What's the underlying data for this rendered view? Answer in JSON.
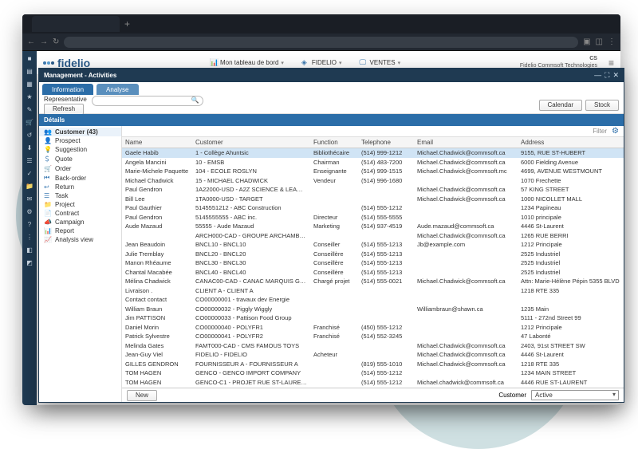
{
  "brand": "fidelio",
  "header": {
    "links": [
      {
        "icon": "📊",
        "label": "Mon tableau de bord"
      },
      {
        "icon": "◈",
        "label": "FIDELIO"
      },
      {
        "icon": "🖵",
        "label": "VENTES"
      }
    ],
    "user_code": "CS",
    "user_org": "Fidelio Commsoft Technologies",
    "menu": "≡"
  },
  "rail_icons": [
    "■",
    "▤",
    "▦",
    "★",
    "✎",
    "🛒",
    "↺",
    "⬇",
    "☰",
    "✓",
    "📁",
    "✉",
    "⚙",
    "?",
    "⋮",
    "◧",
    "◩"
  ],
  "modal": {
    "title": "Management - Activities",
    "tabs": {
      "active": "Information",
      "other": "Analyse"
    },
    "representative_label": "Representative",
    "refresh": "Refresh",
    "calendar": "Calendar",
    "stock": "Stock",
    "details_panel": "Détails",
    "filter": "Filter",
    "new": "New",
    "footer_customer": "Customer",
    "footer_active": "Active"
  },
  "sidebar": {
    "items": [
      {
        "icon": "👥",
        "label": "Customer (43)"
      },
      {
        "icon": "👤",
        "label": "Prospect"
      },
      {
        "icon": "💡",
        "label": "Suggestion"
      },
      {
        "icon": "＄",
        "label": "Quote"
      },
      {
        "icon": "🛒",
        "label": "Order"
      },
      {
        "icon": "⏮",
        "label": "Back-order"
      },
      {
        "icon": "↩",
        "label": "Return"
      },
      {
        "icon": "☰",
        "label": "Task"
      },
      {
        "icon": "📁",
        "label": "Project"
      },
      {
        "icon": "📄",
        "label": "Contract"
      },
      {
        "icon": "📣",
        "label": "Campaign"
      },
      {
        "icon": "📊",
        "label": "Report"
      },
      {
        "icon": "📈",
        "label": "Analysis view"
      }
    ]
  },
  "grid": {
    "columns": [
      "Name",
      "Customer",
      "Function",
      "Telephone",
      "Email",
      "Address"
    ],
    "rows": [
      {
        "name": "Gaele Habib",
        "customer": "1 - Collège Ahuntsic",
        "func": "Bibliothécaire",
        "tel": "(514) 999-1212",
        "email": "Michael.Chadwick@commsoft.ca",
        "addr": "9155, RUE ST-HUBERT"
      },
      {
        "name": "Angela Mancini",
        "customer": "10 - EMSB",
        "func": "Chairman",
        "tel": "(514) 483-7200",
        "email": "Michael.Chadwick@commsoft.ca",
        "addr": "6000 Fielding Avenue"
      },
      {
        "name": "Marie-Michele Paquette",
        "customer": "104 - ECOLE ROSLYN",
        "func": "Enseignante",
        "tel": "(514) 999-1515",
        "email": "Michael.Chadwick@commsoft.mc",
        "addr": "4699, AVENUE WESTMOUNT"
      },
      {
        "name": "Michael Chadwick",
        "customer": "15 - MICHAEL CHADWICK",
        "func": "Vendeur",
        "tel": "(514) 996-1680",
        "email": "",
        "addr": "1070 Frechette"
      },
      {
        "name": "Paul Gendron",
        "customer": "1A22000-USD - A2Z SCIENCE & LEARNING…",
        "func": "",
        "tel": "",
        "email": "Michael.Chadwick@commsoft.ca",
        "addr": "57 KING STREET"
      },
      {
        "name": "Bill Lee",
        "customer": "1TA0000-USD - TARGET",
        "func": "",
        "tel": "",
        "email": "Michael.Chadwick@commsoft.ca",
        "addr": "1000 NICOLLET MALL"
      },
      {
        "name": "Paul Gauthier",
        "customer": "5145551212 - ABC Construction",
        "func": "",
        "tel": "(514) 555-1212",
        "email": "",
        "addr": "1234 Papineau"
      },
      {
        "name": "Paul Gendron",
        "customer": "5145555555 - ABC inc.",
        "func": "Directeur",
        "tel": "(514) 555-5555",
        "email": "",
        "addr": "1010 principale"
      },
      {
        "name": "Aude Mazaud",
        "customer": "55555 - Aude Mazaud",
        "func": "Marketing",
        "tel": "(514) 937-4519",
        "email": "Aude.mazaud@commsoft.ca",
        "addr": "4446 St-Laurent"
      },
      {
        "name": "",
        "customer": "ARCH000-CAD - GROUPE ARCHAMBAULT",
        "func": "",
        "tel": "",
        "email": "Michael.Chadwick@commsoft.ca",
        "addr": "1265 RUE BERRI"
      },
      {
        "name": "Jean Beaudoin",
        "customer": "BNCL10 - BNCL10",
        "func": "Conseiller",
        "tel": "(514) 555-1213",
        "email": "Jb@example.com",
        "addr": "1212 Principale"
      },
      {
        "name": "Julie Tremblay",
        "customer": "BNCL20 - BNCL20",
        "func": "Conseillère",
        "tel": "(514) 555-1213",
        "email": "",
        "addr": "2525 Industriel"
      },
      {
        "name": "Manon Rhéaume",
        "customer": "BNCL30 - BNCL30",
        "func": "Conseillère",
        "tel": "(514) 555-1213",
        "email": "",
        "addr": "2525 Industriel"
      },
      {
        "name": "Chantal Macabée",
        "customer": "BNCL40 - BNCL40",
        "func": "Conseillère",
        "tel": "(514) 555-1213",
        "email": "",
        "addr": "2525 Industriel"
      },
      {
        "name": "Mélina Chadwick",
        "customer": "CANAC00-CAD - CANAC MARQUIS GRENI…",
        "func": "Chargé projet",
        "tel": "(514) 555-0021",
        "email": "Michael.Chadwick@commsoft.ca",
        "addr": "Attn: Marie-Hélène Pépin 5355 BLVD"
      },
      {
        "name": "Livraison .",
        "customer": "CLIENT A - CLIENT A",
        "func": "",
        "tel": "",
        "email": "",
        "addr": "1218 RTE 335"
      },
      {
        "name": "Contact contact",
        "customer": "CO00000001 - travaux dev Energie",
        "func": "",
        "tel": "",
        "email": "",
        "addr": ""
      },
      {
        "name": "William Braun",
        "customer": "CO00000032 - Piggly Wiggly",
        "func": "",
        "tel": "",
        "email": "Williambraun@shawn.ca",
        "addr": "1235 Main"
      },
      {
        "name": "Jim PATTISON",
        "customer": "CO00000033 - Pattison Food Group",
        "func": "",
        "tel": "",
        "email": "",
        "addr": "5111 - 272nd Street 99"
      },
      {
        "name": "Daniel Morin",
        "customer": "CO00000040 - POLYFR1",
        "func": "Franchisé",
        "tel": "(450) 555-1212",
        "email": "",
        "addr": "1212 Principale"
      },
      {
        "name": "Patrick Sylvestre",
        "customer": "CO00000041 - POLYFR2",
        "func": "Franchisé",
        "tel": "(514) 552-3245",
        "email": "",
        "addr": "47 Labonté"
      },
      {
        "name": "Melinda Gates",
        "customer": "FAMT000-CAD - CMS FAMOUS TOYS",
        "func": "",
        "tel": "",
        "email": "Michael.Chadwick@commsoft.ca",
        "addr": "2403, 91st STREET SW"
      },
      {
        "name": "Jean-Guy Viel",
        "customer": "FIDELIO - FIDELIO",
        "func": "Acheteur",
        "tel": "",
        "email": "Michael.Chadwick@commsoft.ca",
        "addr": "4446 St-Laurent"
      },
      {
        "name": "GILLES GENDRON",
        "customer": "FOURNISSEUR A - FOURNISSEUR A",
        "func": "",
        "tel": "(819) 555-1010",
        "email": "Michael.Chadwick@commsoft.ca",
        "addr": "1218 RTE 335"
      },
      {
        "name": "TOM HAGEN",
        "customer": "GENCO - GENCO IMPORT COMPANY",
        "func": "",
        "tel": "(514) 555-1212",
        "email": "",
        "addr": "1234 MAIN STREET"
      },
      {
        "name": "TOM HAGEN",
        "customer": "GENCO-C1 - PROJET RUE ST-LAURENT",
        "func": "",
        "tel": "(514) 555-1212",
        "email": "Michael.chadwick@commsoft.ca",
        "addr": "4446 RUE ST-LAURENT"
      }
    ]
  }
}
